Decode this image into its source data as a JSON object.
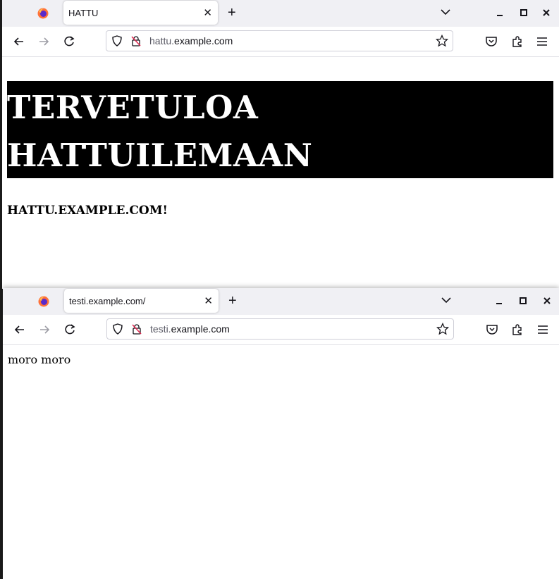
{
  "window1": {
    "tab_title": "HATTU",
    "url_sub": "hattu.",
    "url_domain": "example.com",
    "page": {
      "heading_line1": "TERVETULOA",
      "heading_line2": "HATTUILEMAAN",
      "subheading": "HATTU.EXAMPLE.COM!"
    }
  },
  "window2": {
    "tab_title": "testi.example.com/",
    "url_sub": "testi.",
    "url_domain": "example.com",
    "page": {
      "paragraph": "moro moro"
    }
  },
  "icons": {
    "browser_logo": "firefox-icon",
    "new_tab": "plus-icon",
    "tab_close": "close-icon",
    "list_tabs": "chevron-down-icon",
    "back": "back-arrow-icon",
    "forward": "forward-arrow-icon",
    "reload": "reload-icon",
    "tracking_protection": "shield-icon",
    "connection": "insecure-lock-icon",
    "bookmark": "star-icon",
    "pocket": "pocket-icon",
    "extensions": "puzzle-icon",
    "menu": "hamburger-menu-icon"
  },
  "colors": {
    "tab_strip": "#f0f0f4",
    "banner_bg": "#000000",
    "banner_text": "#ffffff"
  }
}
